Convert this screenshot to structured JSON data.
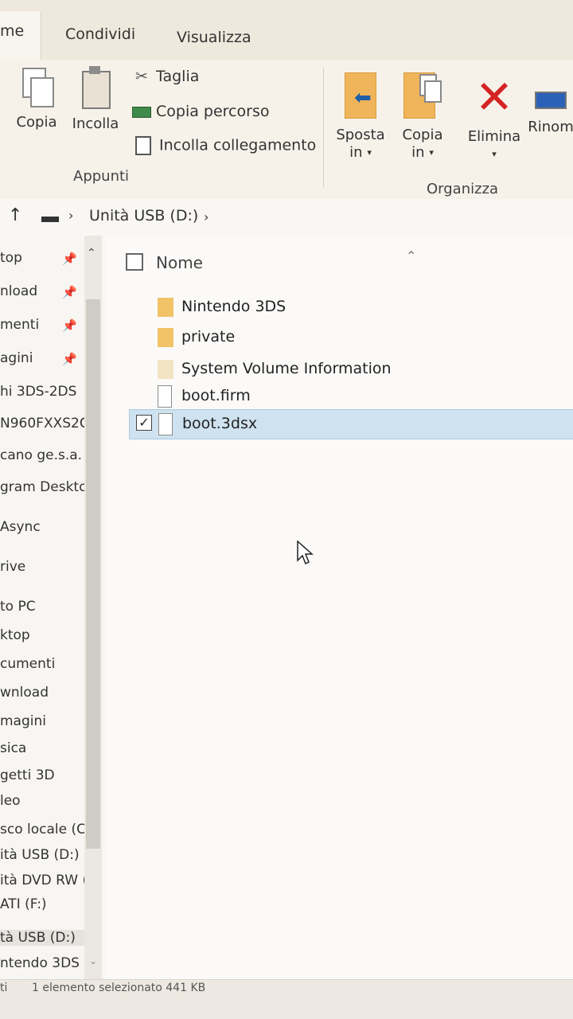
{
  "tabs": {
    "home_partial": "me",
    "share": "Condividi",
    "view": "Visualizza"
  },
  "ribbon": {
    "copy_label": "Copia",
    "paste_label": "Incolla",
    "cut_label": "Taglia",
    "copy_path_label": "Copia percorso",
    "paste_shortcut_label": "Incolla collegamento",
    "clipboard_group": "Appunti",
    "move_to_label_1": "Sposta",
    "move_to_label_2": "in",
    "copy_to_label_1": "Copia",
    "copy_to_label_2": "in",
    "delete_label": "Elimina",
    "rename_label": "Rinom",
    "organize_group": "Organizza"
  },
  "address": {
    "crumb": "Unità USB (D:)"
  },
  "nav": {
    "items": [
      "top",
      "nload",
      "menti",
      "agini",
      "hi 3DS-2DS",
      "N960FXXS2C",
      "cano ge.s.a.",
      "gram Desktc",
      "Async",
      "rive",
      "to PC",
      "ktop",
      "cumenti",
      "wnload",
      "magini",
      "sica",
      "getti 3D",
      "leo",
      "sco locale (C:)",
      "ità USB (D:)",
      "ità DVD RW (E",
      "ATI (F:)",
      "tà USB (D:)",
      "ntendo 3DS"
    ]
  },
  "files": {
    "header_name": "Nome",
    "rows": [
      {
        "name": "Nintendo 3DS",
        "type": "folder"
      },
      {
        "name": "private",
        "type": "folder"
      },
      {
        "name": "System Volume Information",
        "type": "folder-hidden"
      },
      {
        "name": "boot.firm",
        "type": "file"
      },
      {
        "name": "boot.3dsx",
        "type": "file",
        "selected": true
      }
    ]
  },
  "status": {
    "count_partial": "ti",
    "selection": "1 elemento selezionato  441 KB"
  }
}
